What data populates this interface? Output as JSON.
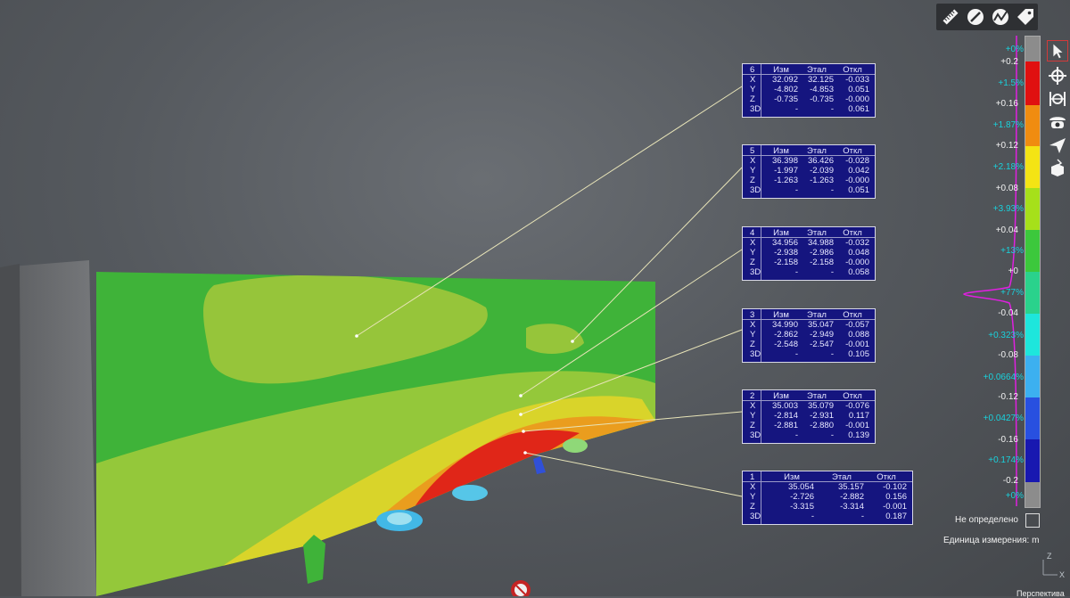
{
  "toolbar": {
    "icons": [
      "ruler-icon",
      "probe-edit-icon",
      "curve-probe-icon",
      "tag-icon"
    ]
  },
  "right_tools": {
    "icons": [
      "select-cursor-icon",
      "move-crosshair-icon",
      "fit-distance-icon",
      "camera-view-icon",
      "send-icon",
      "section-box-icon"
    ]
  },
  "measurements": [
    {
      "id": "6",
      "headers": [
        "Изм",
        "Этал",
        "Откл"
      ],
      "rows": [
        [
          "X",
          "32.092",
          "32.125",
          "-0.033"
        ],
        [
          "Y",
          "-4.802",
          "-4.853",
          "0.051"
        ],
        [
          "Z",
          "-0.735",
          "-0.735",
          "-0.000"
        ],
        [
          "3D",
          "-",
          "-",
          "0.061"
        ]
      ]
    },
    {
      "id": "5",
      "headers": [
        "Изм",
        "Этал",
        "Откл"
      ],
      "rows": [
        [
          "X",
          "36.398",
          "36.426",
          "-0.028"
        ],
        [
          "Y",
          "-1.997",
          "-2.039",
          "0.042"
        ],
        [
          "Z",
          "-1.263",
          "-1.263",
          "-0.000"
        ],
        [
          "3D",
          "-",
          "-",
          "0.051"
        ]
      ]
    },
    {
      "id": "4",
      "headers": [
        "Изм",
        "Этал",
        "Откл"
      ],
      "rows": [
        [
          "X",
          "34.956",
          "34.988",
          "-0.032"
        ],
        [
          "Y",
          "-2.938",
          "-2.986",
          "0.048"
        ],
        [
          "Z",
          "-2.158",
          "-2.158",
          "-0.000"
        ],
        [
          "3D",
          "-",
          "-",
          "0.058"
        ]
      ]
    },
    {
      "id": "3",
      "headers": [
        "Изм",
        "Этал",
        "Откл"
      ],
      "rows": [
        [
          "X",
          "34.990",
          "35.047",
          "-0.057"
        ],
        [
          "Y",
          "-2.862",
          "-2.949",
          "0.088"
        ],
        [
          "Z",
          "-2.548",
          "-2.547",
          "-0.001"
        ],
        [
          "3D",
          "-",
          "-",
          "0.105"
        ]
      ]
    },
    {
      "id": "2",
      "headers": [
        "Изм",
        "Этал",
        "Откл"
      ],
      "rows": [
        [
          "X",
          "35.003",
          "35.079",
          "-0.076"
        ],
        [
          "Y",
          "-2.814",
          "-2.931",
          "0.117"
        ],
        [
          "Z",
          "-2.881",
          "-2.880",
          "-0.001"
        ],
        [
          "3D",
          "-",
          "-",
          "0.139"
        ]
      ]
    },
    {
      "id": "1",
      "headers": [
        "Изм",
        "Этал",
        "Откл"
      ],
      "rows": [
        [
          "X",
          "35.054",
          "35.157",
          "-0.102"
        ],
        [
          "Y",
          "-2.726",
          "-2.882",
          "0.156"
        ],
        [
          "Z",
          "-3.315",
          "-3.314",
          "-0.001"
        ],
        [
          "3D",
          "-",
          "-",
          "0.187"
        ]
      ]
    }
  ],
  "scale": {
    "values": [
      "+0.2",
      "+0.16",
      "+0.12",
      "+0.08",
      "+0.04",
      "+0",
      "-0.04",
      "-0.08",
      "-0.12",
      "-0.16",
      "-0.2"
    ],
    "percents": [
      "+0%",
      "+1.5%",
      "+1.87%",
      "+2.18%",
      "+3.93%",
      "+13%",
      "+77%",
      "+0.323%",
      "+0.0664%",
      "+0.0427%",
      "+0.174%",
      "+0%"
    ],
    "colors": [
      "#8c8c8c",
      "#e01010",
      "#f08c10",
      "#f4e414",
      "#a6e01a",
      "#3cc83c",
      "#2ad28c",
      "#1ee6dc",
      "#3cb0f0",
      "#2850e0",
      "#1818b0",
      "#8c8c8c"
    ],
    "undefined_label": "Не определено",
    "units_label": "Единица измерения: m"
  },
  "axis_labels": {
    "z": "Z",
    "x": "X"
  },
  "bottom_label": "Перспектива"
}
